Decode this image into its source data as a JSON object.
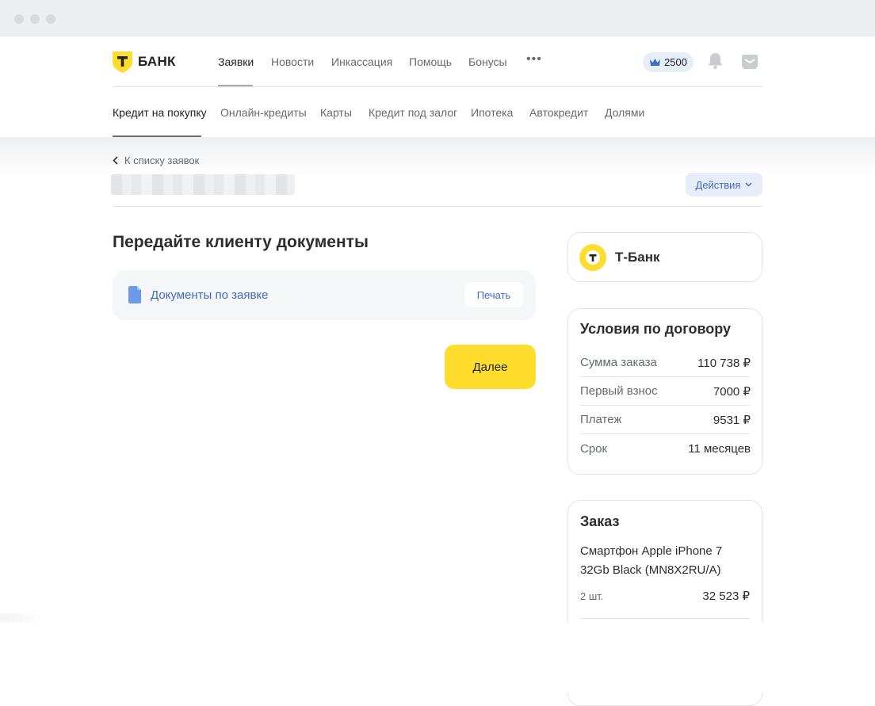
{
  "brand": {
    "name": "БАНК",
    "logo_letter": "Т",
    "accent": "#ffdd2d",
    "link_color": "#3f6bc5"
  },
  "topnav": {
    "items": [
      "Заявки",
      "Новости",
      "Инкассация",
      "Помощь",
      "Бонусы"
    ],
    "more": "•••",
    "points": "2500"
  },
  "subnav": {
    "items": [
      "Кредит на покупку",
      "Онлайн-кредиты",
      "Карты",
      "Кредит под залог",
      "Ипотека",
      "Автокредит",
      "Долями"
    ]
  },
  "page": {
    "back_link": "К списку заявок",
    "actions_label": "Действия",
    "title": "Передайте клиенту документы",
    "documents_link": "Документы по заявке",
    "print_label": "Печать",
    "next_label": "Далее"
  },
  "bank_card": {
    "logo_letter": "т",
    "name": "Т-Банк"
  },
  "terms": {
    "title": "Условия по договору",
    "rows": [
      {
        "label": "Сумма заказа",
        "value": "110 738 ₽"
      },
      {
        "label": "Первый взнос",
        "value": "7000 ₽"
      },
      {
        "label": "Платеж",
        "value": "9531 ₽"
      },
      {
        "label": "Срок",
        "value": "11 месяцев"
      }
    ]
  },
  "order": {
    "title": "Заказ",
    "product": "Смартфон Apple iPhone 7 32Gb Black (MN8X2RU/A)",
    "quantity": "2 шт.",
    "price": "32 523 ₽"
  }
}
